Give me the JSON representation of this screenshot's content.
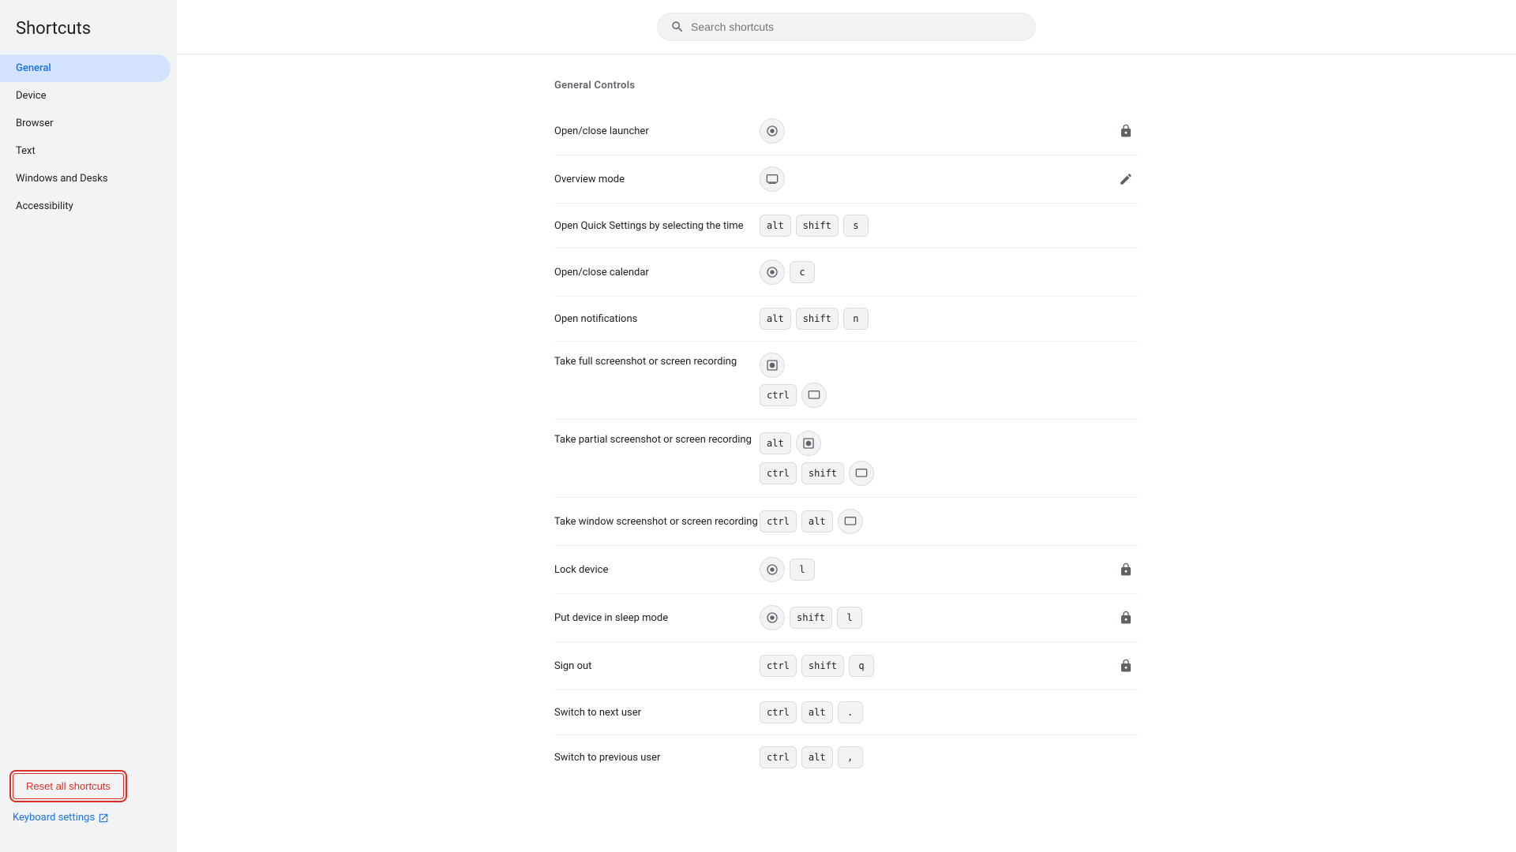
{
  "app": {
    "title": "Shortcuts"
  },
  "search": {
    "placeholder": "Search shortcuts"
  },
  "sidebar": {
    "items": [
      {
        "id": "general",
        "label": "General",
        "active": true
      },
      {
        "id": "device",
        "label": "Device",
        "active": false
      },
      {
        "id": "browser",
        "label": "Browser",
        "active": false
      },
      {
        "id": "text",
        "label": "Text",
        "active": false
      },
      {
        "id": "windows-desks",
        "label": "Windows and Desks",
        "active": false
      },
      {
        "id": "accessibility",
        "label": "Accessibility",
        "active": false
      }
    ],
    "bottom": {
      "reset_label": "Reset all shortcuts",
      "keyboard_settings_label": "Keyboard settings"
    }
  },
  "main": {
    "section_title": "General Controls",
    "shortcuts": [
      {
        "id": "open-close-launcher",
        "label": "Open/close launcher",
        "keys": [
          {
            "type": "circle-icon",
            "value": "⊙"
          }
        ],
        "locked": true,
        "editable": false
      },
      {
        "id": "overview-mode",
        "label": "Overview mode",
        "keys": [
          {
            "type": "rect-icon",
            "value": "▭"
          }
        ],
        "locked": false,
        "editable": true
      },
      {
        "id": "open-quick-settings",
        "label": "Open Quick Settings by selecting the time",
        "keys": [
          {
            "type": "badge",
            "value": "alt"
          },
          {
            "type": "badge",
            "value": "shift"
          },
          {
            "type": "badge",
            "value": "s"
          }
        ],
        "locked": false,
        "editable": false
      },
      {
        "id": "open-close-calendar",
        "label": "Open/close calendar",
        "keys": [
          {
            "type": "circle-icon",
            "value": "⊙"
          },
          {
            "type": "badge",
            "value": "c"
          }
        ],
        "locked": false,
        "editable": false
      },
      {
        "id": "open-notifications",
        "label": "Open notifications",
        "keys": [
          {
            "type": "badge",
            "value": "alt"
          },
          {
            "type": "badge",
            "value": "shift"
          },
          {
            "type": "badge",
            "value": "n"
          }
        ],
        "locked": false,
        "editable": false
      },
      {
        "id": "take-full-screenshot",
        "label": "Take full screenshot or screen recording",
        "keys_line1": [
          {
            "type": "screenshot-icon",
            "value": "⬜"
          }
        ],
        "keys_line2": [
          {
            "type": "badge",
            "value": "ctrl"
          },
          {
            "type": "rect-icon",
            "value": "▭"
          }
        ],
        "multi": true,
        "locked": false,
        "editable": false
      },
      {
        "id": "take-partial-screenshot",
        "label": "Take partial screenshot or screen recording",
        "keys_line1": [
          {
            "type": "badge",
            "value": "alt"
          },
          {
            "type": "screenshot-icon",
            "value": "⬜"
          }
        ],
        "keys_line2": [
          {
            "type": "badge",
            "value": "ctrl"
          },
          {
            "type": "badge",
            "value": "shift"
          },
          {
            "type": "rect-icon",
            "value": "▭"
          }
        ],
        "multi": true,
        "locked": false,
        "editable": false
      },
      {
        "id": "take-window-screenshot",
        "label": "Take window screenshot or screen recording",
        "keys": [
          {
            "type": "badge",
            "value": "ctrl"
          },
          {
            "type": "badge",
            "value": "alt"
          },
          {
            "type": "rect-icon",
            "value": "▭"
          }
        ],
        "locked": false,
        "editable": false
      },
      {
        "id": "lock-device",
        "label": "Lock device",
        "keys": [
          {
            "type": "circle-icon",
            "value": "⊙"
          },
          {
            "type": "badge",
            "value": "l"
          }
        ],
        "locked": true,
        "editable": false
      },
      {
        "id": "sleep-mode",
        "label": "Put device in sleep mode",
        "keys": [
          {
            "type": "circle-icon",
            "value": "⊙"
          },
          {
            "type": "badge",
            "value": "shift"
          },
          {
            "type": "badge",
            "value": "l"
          }
        ],
        "locked": true,
        "editable": false
      },
      {
        "id": "sign-out",
        "label": "Sign out",
        "keys": [
          {
            "type": "badge",
            "value": "ctrl"
          },
          {
            "type": "badge",
            "value": "shift"
          },
          {
            "type": "badge",
            "value": "q"
          }
        ],
        "locked": true,
        "editable": false
      },
      {
        "id": "switch-next-user",
        "label": "Switch to next user",
        "keys": [
          {
            "type": "badge",
            "value": "ctrl"
          },
          {
            "type": "badge",
            "value": "alt"
          },
          {
            "type": "badge",
            "value": "."
          }
        ],
        "locked": false,
        "editable": false
      },
      {
        "id": "switch-previous-user",
        "label": "Switch to previous user",
        "keys": [
          {
            "type": "badge",
            "value": "ctrl"
          },
          {
            "type": "badge",
            "value": "alt"
          },
          {
            "type": "badge",
            "value": ","
          }
        ],
        "locked": false,
        "editable": false
      }
    ]
  }
}
